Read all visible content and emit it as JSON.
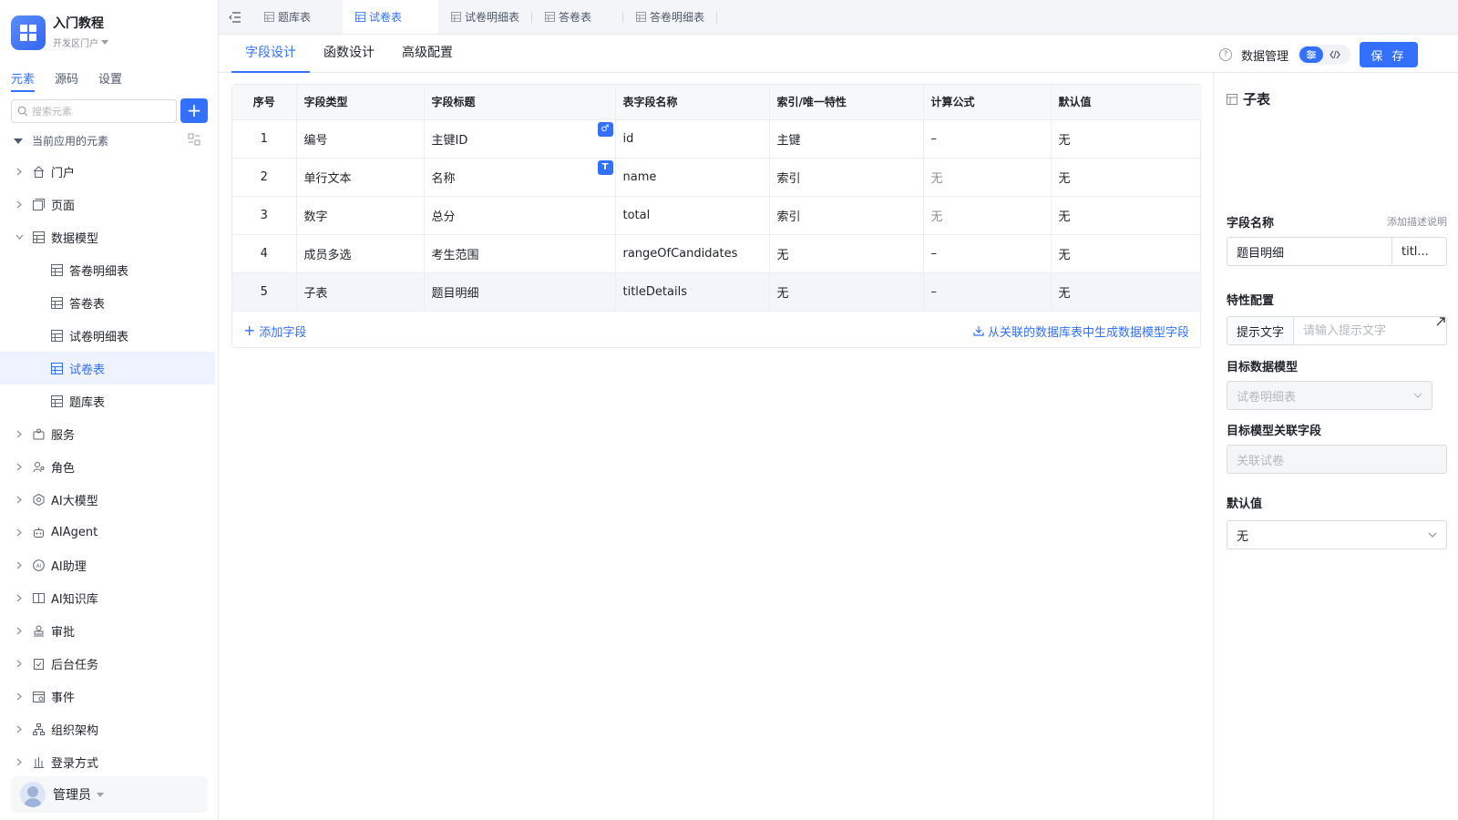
{
  "app": {
    "title": "入门教程",
    "subtitle": "开发区门户"
  },
  "sidebar": {
    "tabs": [
      "元素",
      "源码",
      "设置"
    ],
    "search_placeholder": "搜索元素",
    "section_title": "当前应用的元素",
    "items": [
      {
        "label": "门户",
        "icon": "home-icon"
      },
      {
        "label": "页面",
        "icon": "page-icon"
      },
      {
        "label": "数据模型",
        "icon": "table-icon",
        "expanded": true
      },
      {
        "label": "答卷明细表",
        "icon": "table-icon",
        "child": true
      },
      {
        "label": "答卷表",
        "icon": "table-icon",
        "child": true
      },
      {
        "label": "试卷明细表",
        "icon": "table-icon",
        "child": true
      },
      {
        "label": "试卷表",
        "icon": "table-icon",
        "child": true,
        "selected": true
      },
      {
        "label": "题库表",
        "icon": "table-icon",
        "child": true
      },
      {
        "label": "服务",
        "icon": "service-icon"
      },
      {
        "label": "角色",
        "icon": "role-icon"
      },
      {
        "label": "AI大模型",
        "icon": "model-icon"
      },
      {
        "label": "AIAgent",
        "icon": "robot-icon"
      },
      {
        "label": "AI助理",
        "icon": "ai-assistant-icon"
      },
      {
        "label": "AI知识库",
        "icon": "book-icon"
      },
      {
        "label": "审批",
        "icon": "stamp-icon"
      },
      {
        "label": "后台任务",
        "icon": "task-icon"
      },
      {
        "label": "事件",
        "icon": "event-icon"
      },
      {
        "label": "组织架构",
        "icon": "org-icon"
      },
      {
        "label": "登录方式",
        "icon": "login-icon"
      }
    ],
    "user": {
      "name": "管理员"
    }
  },
  "file_tabs": [
    {
      "label": "题库表",
      "active": false
    },
    {
      "label": "试卷表",
      "active": true
    },
    {
      "label": "试卷明细表",
      "active": false
    },
    {
      "label": "答卷表",
      "active": false
    },
    {
      "label": "答卷明细表",
      "active": false
    }
  ],
  "sub_tabs": [
    "字段设计",
    "函数设计",
    "高级配置"
  ],
  "toolbar": {
    "data_manage": "数据管理",
    "save": "保 存"
  },
  "table": {
    "columns": [
      "序号",
      "字段类型",
      "字段标题",
      "表字段名称",
      "索引/唯一特性",
      "计算公式",
      "默认值"
    ],
    "rows": [
      {
        "no": "1",
        "type": "编号",
        "title": "主键ID",
        "name": "id",
        "index": "主键",
        "formula": "–",
        "default": "无",
        "badge": "♂"
      },
      {
        "no": "2",
        "type": "单行文本",
        "title": "名称",
        "name": "name",
        "index": "索引",
        "formula": "无",
        "default": "无",
        "badge": "T"
      },
      {
        "no": "3",
        "type": "数字",
        "title": "总分",
        "name": "total",
        "index": "索引",
        "formula": "无",
        "default": "无"
      },
      {
        "no": "4",
        "type": "成员多选",
        "title": "考生范围",
        "name": "rangeOfCandidates",
        "index": "无",
        "formula": "–",
        "default": "无"
      },
      {
        "no": "5",
        "type": "子表",
        "title": "题目明细",
        "name": "titleDetails",
        "index": "无",
        "formula": "–",
        "default": "无"
      }
    ],
    "add_field": "添加字段",
    "generate": "从关联的数据库表中生成数据模型字段"
  },
  "panel": {
    "title": "子表",
    "field_name_label": "字段名称",
    "add_desc": "添加描述说明",
    "field_name_value": "题目明细",
    "field_code_value": "titl...",
    "feature_label": "特性配置",
    "hint_label": "提示文字",
    "hint_placeholder": "请输入提示文字",
    "target_model_label": "目标数据模型",
    "target_model_value": "试卷明细表",
    "relation_label": "目标模型关联字段",
    "relation_value": "关联试卷",
    "default_label": "默认值",
    "default_value": "无"
  },
  "colors": {
    "primary": "#3370ff",
    "text": "#1f2329",
    "muted": "#8a8f99"
  }
}
